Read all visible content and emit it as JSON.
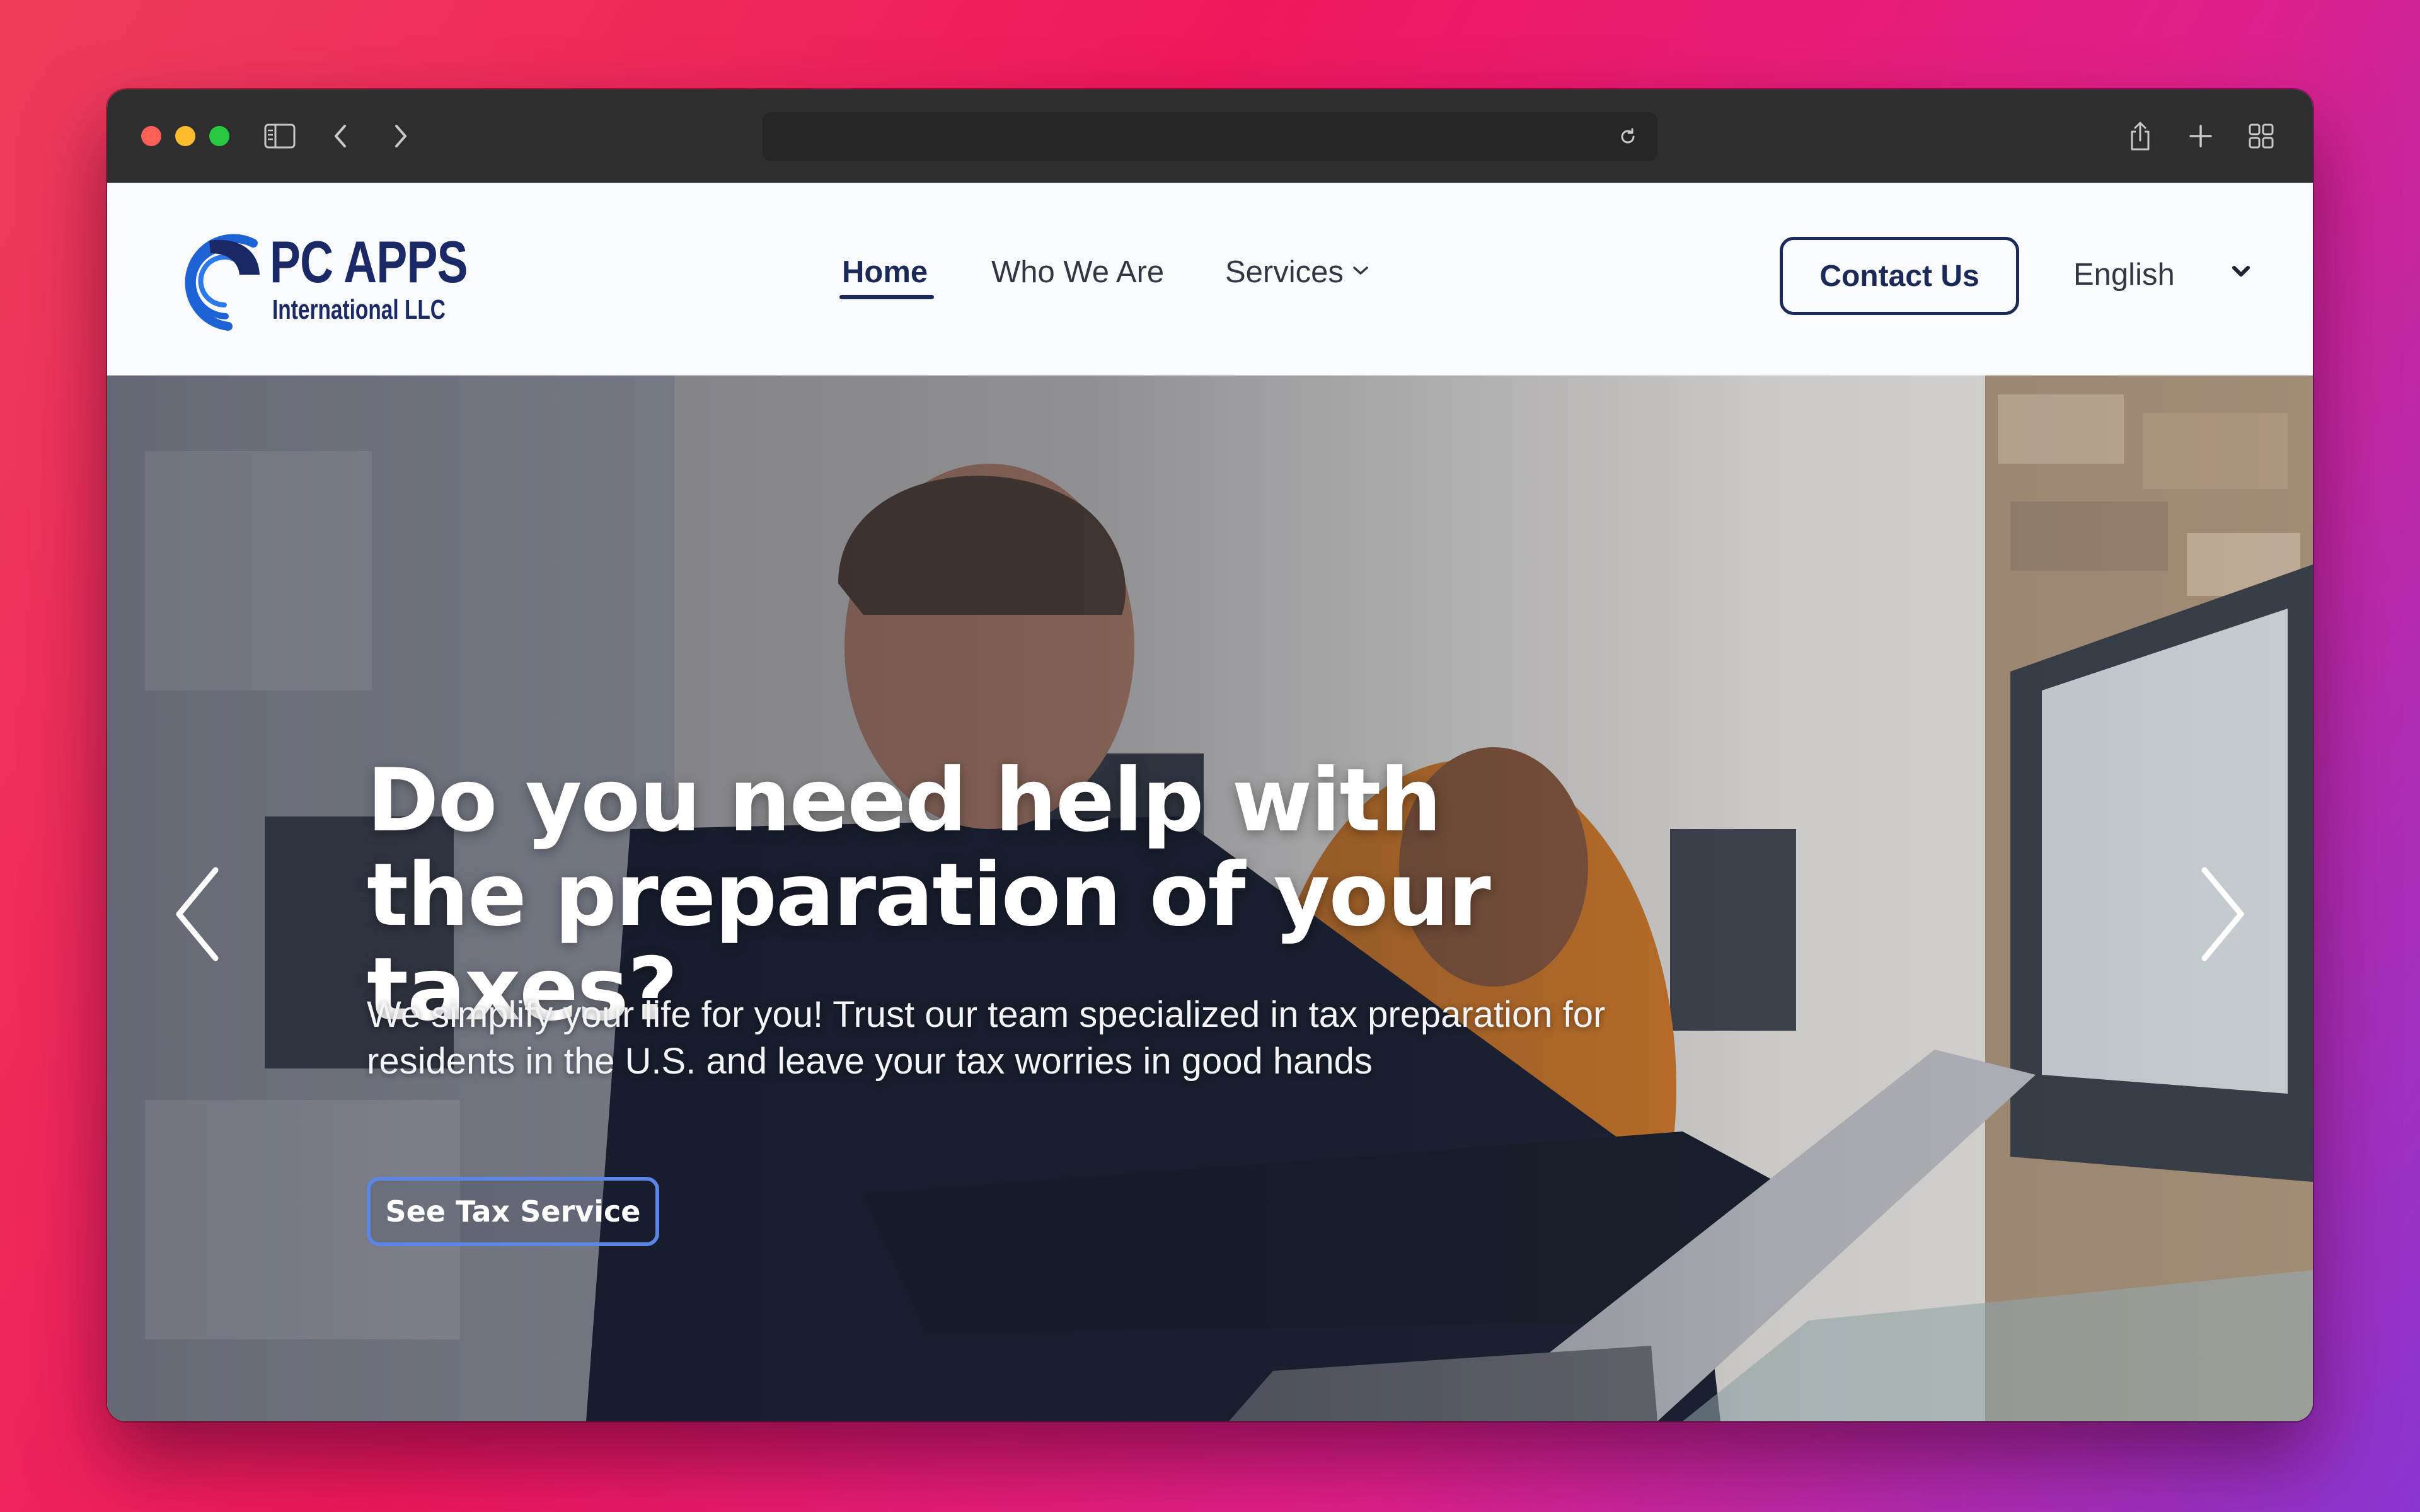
{
  "browser": {
    "icons": [
      "sidebar-toggle-icon",
      "back-arrow-icon",
      "forward-arrow-icon",
      "reload-icon",
      "share-icon",
      "new-tab-icon",
      "tab-overview-icon"
    ],
    "url": ""
  },
  "header": {
    "logo": {
      "title": "PC APPS",
      "subtitle": "International LLC"
    },
    "nav": [
      {
        "label": "Home",
        "active": true
      },
      {
        "label": "Who We Are",
        "active": false
      },
      {
        "label": "Services",
        "active": false,
        "has_dropdown": true
      }
    ],
    "contact_label": "Contact Us",
    "language": {
      "selected": "English"
    }
  },
  "hero": {
    "title": "Do you need help with the preparation of your taxes?",
    "text": "We simplify your life for you! Trust our team specialized in tax preparation for residents in the U.S. and leave your tax worries in good hands",
    "button_label": "See Tax Service",
    "slides": {
      "count": 3,
      "active": 1
    }
  },
  "colors": {
    "brand_navy": "#1a2957",
    "logo_blue": "#1e63d6",
    "hero_button_border": "#5b86e5",
    "toolbar": "#2e2e2f"
  }
}
